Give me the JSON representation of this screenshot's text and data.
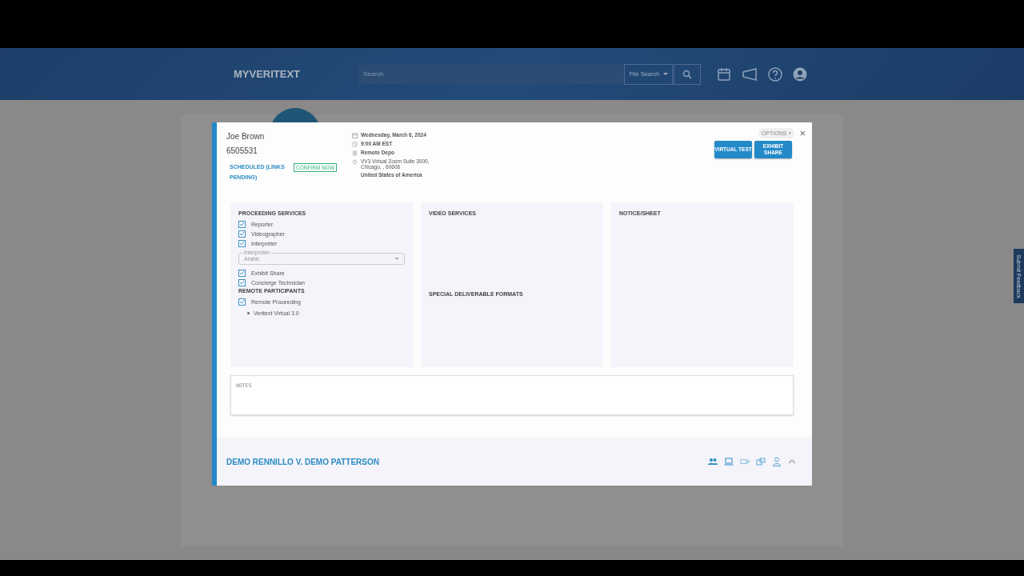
{
  "header": {
    "logo": "MYVERITEXT",
    "search": {
      "placeholder": "Search"
    },
    "search_scope": "File Search"
  },
  "feedback_tab": "Submit Feedback",
  "modal": {
    "name": "Joe Brown",
    "job_number": "6505531",
    "status": "SCHEDULED (LINKS PENDING)",
    "confirm": "CONFIRM NOW",
    "details": [
      {
        "kind": "calendar",
        "text": "Wednesday, March 6, 2024"
      },
      {
        "kind": "clock",
        "text": "9:00 AM EST"
      },
      {
        "kind": "building",
        "text": "Remote Depo"
      },
      {
        "kind": "pin",
        "text": "VV3 Virtual Zoom Suite 3000, Chicago, , 60606"
      },
      {
        "kind": "none",
        "text": "United States of America"
      }
    ],
    "options": "OPTIONS +",
    "buttons": [
      "VIRTUAL TEST",
      "EXHIBIT SHARE"
    ],
    "close": "×",
    "proceeding": {
      "title": "PROCEEDING SERVICES",
      "items": [
        {
          "kind": "checkbox",
          "label": "Reporter",
          "checked": true
        },
        {
          "kind": "checkbox",
          "label": "Videographer",
          "checked": true
        },
        {
          "kind": "checkbox",
          "label": "Interpreter",
          "checked": true
        },
        {
          "kind": "select",
          "label": "Interpreter",
          "value": "Arabic"
        },
        {
          "kind": "checkbox",
          "label": "Exhibit Share",
          "checked": true
        },
        {
          "kind": "checkbox",
          "label": "Concierge Technician",
          "checked": true
        }
      ]
    },
    "remote": {
      "title": "REMOTE PARTICIPANTS",
      "items": [
        {
          "label": "Remote Proceeding",
          "checked": true
        }
      ],
      "bullets": [
        "Veritext Virtual 3.0"
      ]
    },
    "video_title": "VIDEO SERVICES",
    "formats_title": "SPECIAL DELIVERABLE FORMATS",
    "notice_title": "NOTICE/SHEET",
    "notes": {
      "placeholder": "NOTES"
    },
    "case": "DEMO RENNILLO V. DEMO PATTERSON"
  }
}
